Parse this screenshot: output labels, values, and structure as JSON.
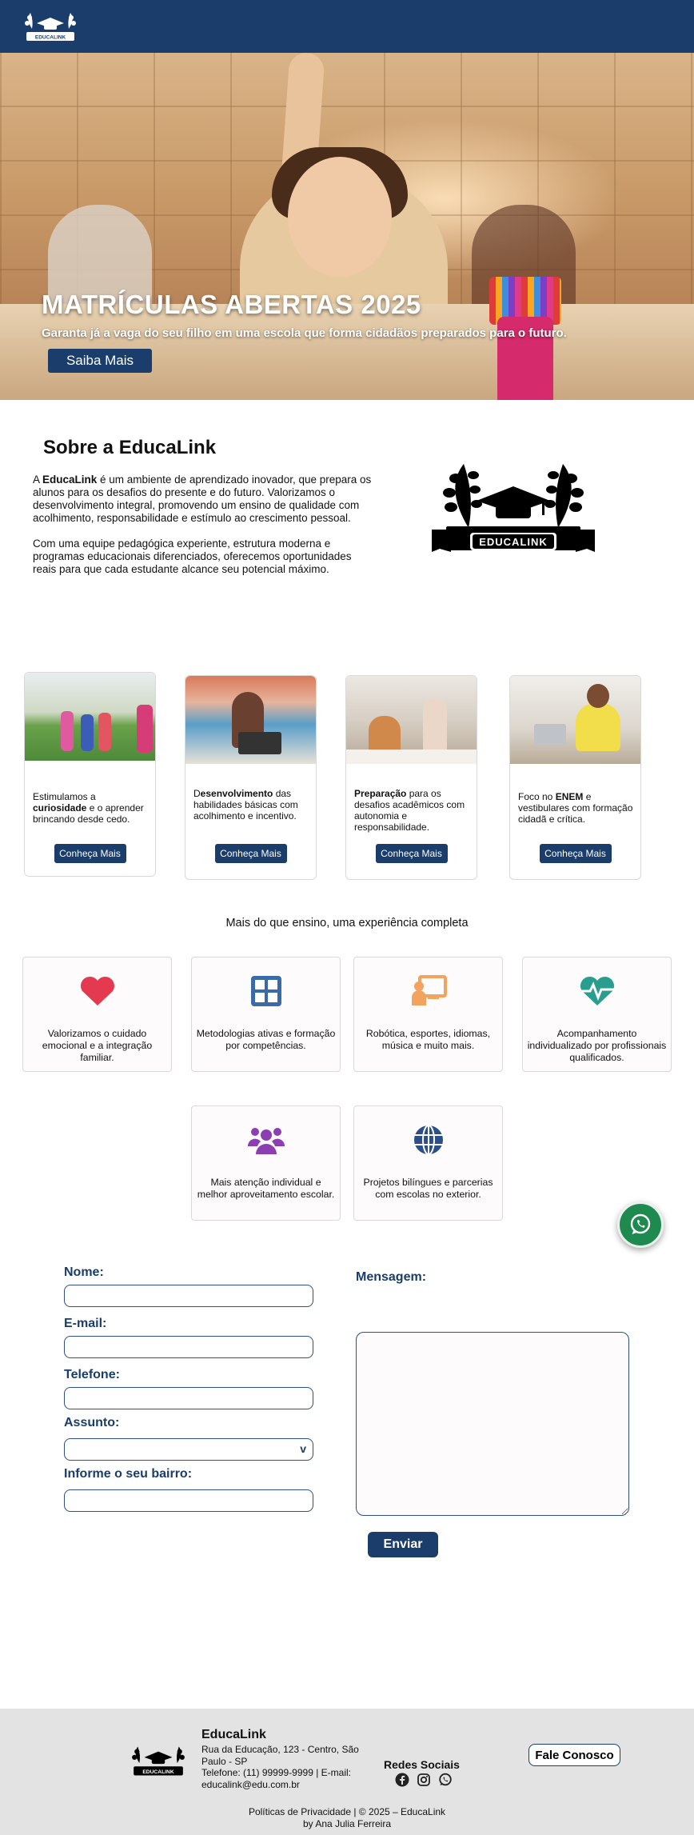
{
  "header": {
    "logo_text": "EDUCALINK"
  },
  "hero": {
    "title": "MATRÍCULAS ABERTAS 2025",
    "subtitle": "Garanta já a vaga do seu filho em uma escola que forma cidadãos preparados para o futuro.",
    "button": "Saiba Mais"
  },
  "about": {
    "title": "Sobre a EducaLink",
    "p1_pre": "A ",
    "p1_brand": "EducaLink",
    "p1_post": " é um ambiente de aprendizado inovador, que prepara os alunos para os desafios do presente e do futuro. Valorizamos o desenvolvimento integral, promovendo um ensino de qualidade com acolhimento, responsabilidade e estímulo ao crescimento pessoal.",
    "p2": "Com uma equipe pedagógica experiente, estrutura moderna e programas educacionais diferenciados, oferecemos oportunidades reais para que cada estudante alcance seu potencial máximo.",
    "logo_text": "EDUCALINK"
  },
  "cards": [
    {
      "pre": "Estimulamos a ",
      "bold": "curiosidade",
      "post": " e o aprender brincando desde cedo.",
      "button": "Conheça Mais"
    },
    {
      "pre": "D",
      "bold": "esenvolvimento",
      "post": " das habilidades básicas com acolhimento e incentivo.",
      "button": "Conheça Mais"
    },
    {
      "pre": "",
      "bold": "Preparação",
      "post": " para os desafios acadêmicos com autonomia e responsabilidade.",
      "button": "Conheça Mais"
    },
    {
      "pre": "Foco no ",
      "bold": "ENEM",
      "post": " e vestibulares com formação cidadã e crítica.",
      "button": "Conheça Mais"
    }
  ],
  "tagline": "Mais do que ensino, uma experiência completa",
  "features": [
    {
      "icon": "heart-icon",
      "color": "#e53950",
      "text": "Valorizamos o cuidado emocional e a integração familiar."
    },
    {
      "icon": "grid-icon",
      "color": "#3a6aa8",
      "text": "Metodologias ativas e formação por competências."
    },
    {
      "icon": "teacher-board-icon",
      "color": "#f2a35e",
      "text": "Robótica, esportes, idiomas, música e muito mais."
    },
    {
      "icon": "heart-pulse-icon",
      "color": "#2a9e8e",
      "text": "Acompanhamento individualizado por profissionais qualificados."
    },
    {
      "icon": "users-icon",
      "color": "#8c3fb0",
      "text": "Mais atenção individual e melhor aproveitamento escolar."
    },
    {
      "icon": "globe-icon",
      "color": "#2b4f86",
      "text": "Projetos bilíngues e parcerias com escolas no exterior."
    }
  ],
  "form": {
    "name_label": "Nome:",
    "email_label": "E-mail:",
    "phone_label": "Telefone:",
    "subject_label": "Assunto:",
    "neighborhood_label": "Informe o seu bairro:",
    "message_label": "Mensagem:",
    "select_chevron": "v",
    "submit": "Enviar"
  },
  "footer": {
    "name": "EducaLink",
    "address": "Rua da Educação, 123 - Centro, São Paulo - SP",
    "contact": "Telefone: (11) 99999-9999 | E-mail: educalink@edu.com.br",
    "social_title": "Redes Sociais",
    "contact_button": "Fale Conosco",
    "copyright": "Políticas de Privacidade | © 2025 – EducaLink",
    "author": "by Ana Julia Ferreira",
    "logo_text": "EDUCALINK"
  }
}
